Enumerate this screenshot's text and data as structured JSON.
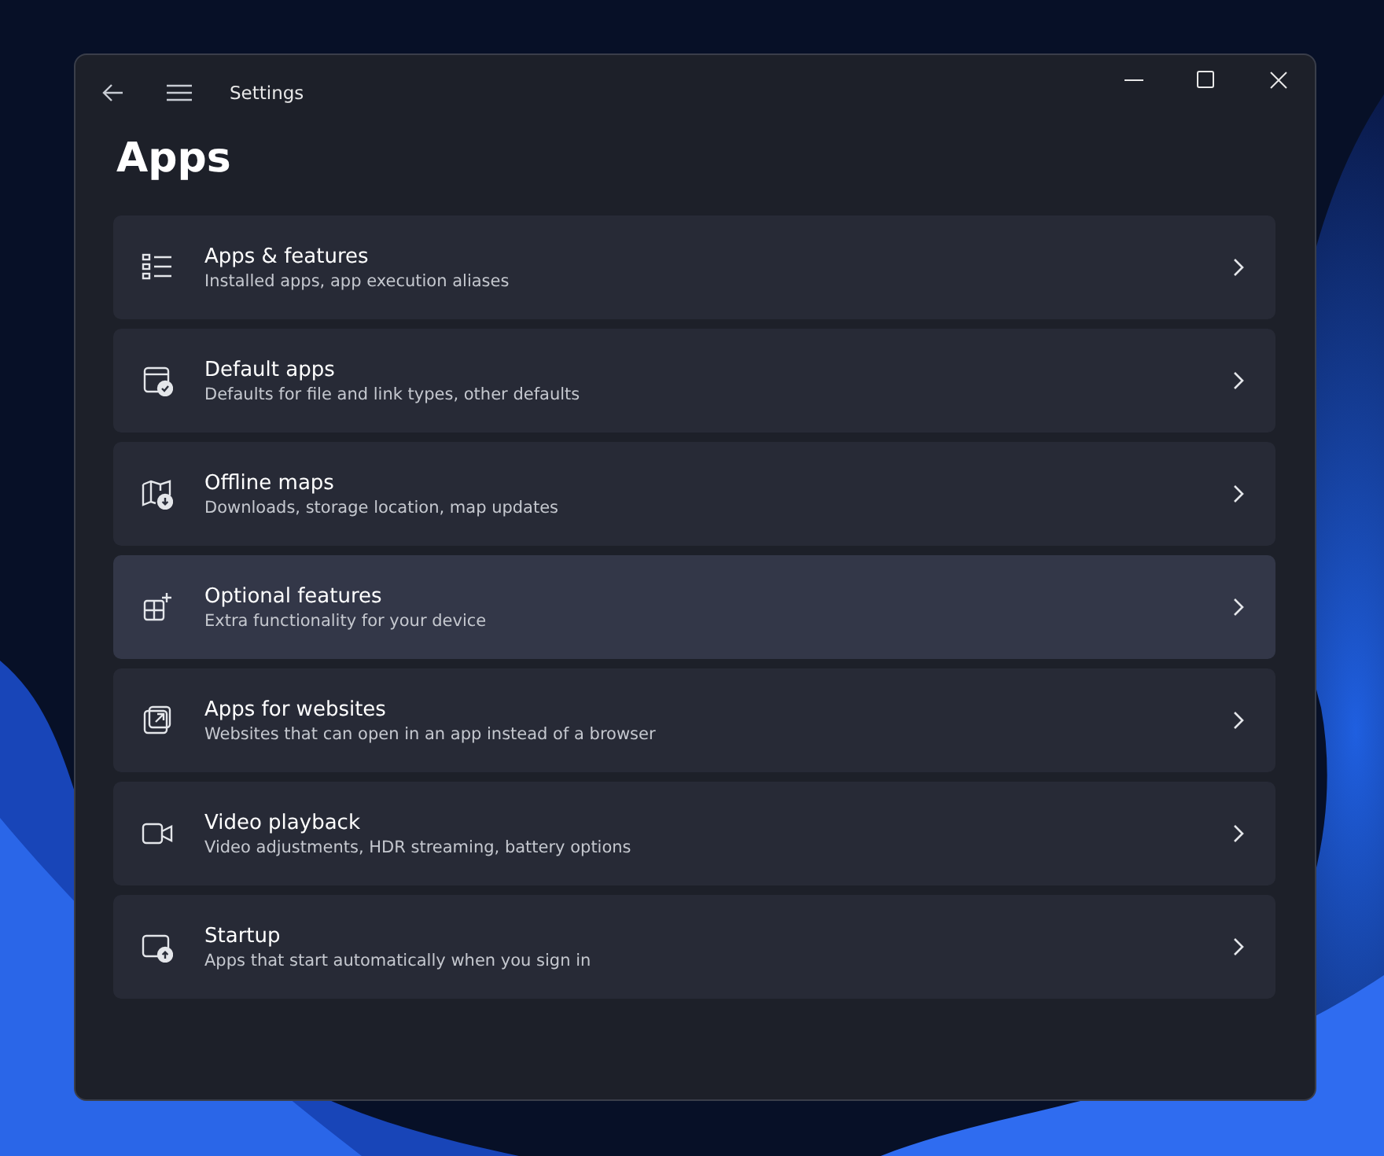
{
  "window": {
    "title": "Settings"
  },
  "page_title": "Apps",
  "items": [
    {
      "title": "Apps & features",
      "subtitle": "Installed apps, app execution aliases",
      "hovered": false
    },
    {
      "title": "Default apps",
      "subtitle": "Defaults for file and link types, other defaults",
      "hovered": false
    },
    {
      "title": "Offline maps",
      "subtitle": "Downloads, storage location, map updates",
      "hovered": false
    },
    {
      "title": "Optional features",
      "subtitle": "Extra functionality for your device",
      "hovered": true
    },
    {
      "title": "Apps for websites",
      "subtitle": "Websites that can open in an app instead of a browser",
      "hovered": false
    },
    {
      "title": "Video playback",
      "subtitle": "Video adjustments, HDR streaming, battery options",
      "hovered": false
    },
    {
      "title": "Startup",
      "subtitle": "Apps that start automatically when you sign in",
      "hovered": false
    }
  ]
}
